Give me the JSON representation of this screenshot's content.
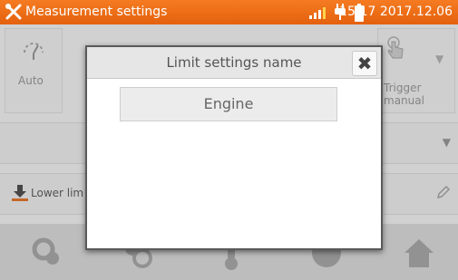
{
  "status_bar": {
    "title": "Measurement settings",
    "time": "15:17 2017.12.06",
    "icons": [
      "tools-icon",
      "signal-icon",
      "plug-icon",
      "battery-icon"
    ]
  },
  "tiles": [
    {
      "icon": "auto-icon",
      "label": "Auto"
    },
    {
      "icon": "hand-icon",
      "label_line1": "Trigger",
      "label_line2": "manual"
    }
  ],
  "lower_limit": {
    "icon": "lower-limit-icon",
    "label": "Lower lim"
  },
  "bottom_nav": [
    "measurement-icon",
    "settings-icon",
    "thermometer-icon",
    "help-icon",
    "home-icon"
  ],
  "dialog": {
    "title": "Limit settings name",
    "options": [
      "Engine"
    ]
  },
  "colors": {
    "accent": "#f06d1a",
    "overlay": "#8a8a8a"
  }
}
